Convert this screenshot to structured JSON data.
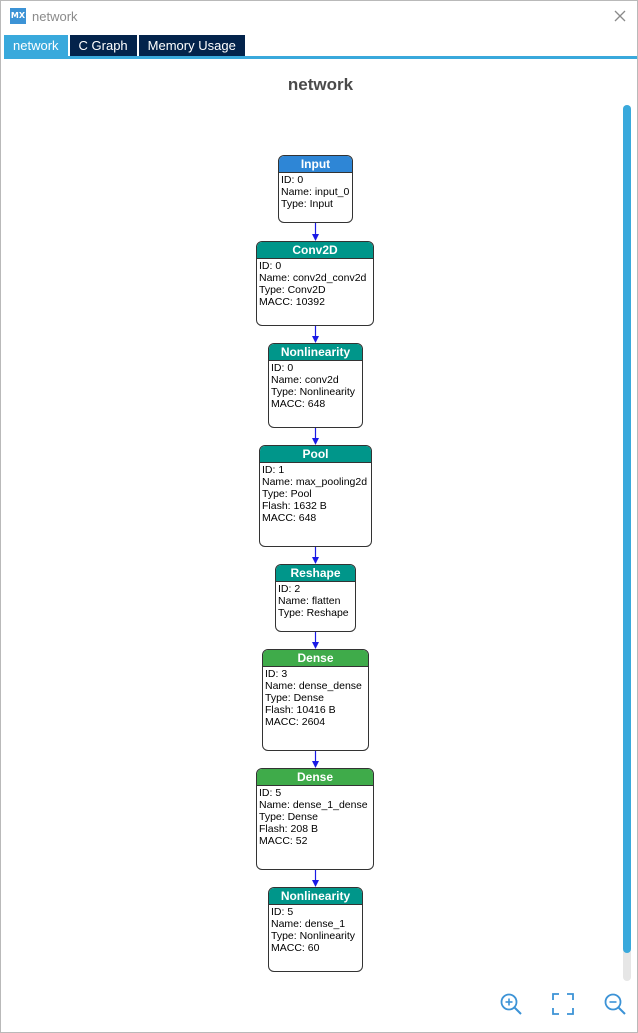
{
  "window": {
    "title": "network",
    "app_icon": "MX"
  },
  "tabs": [
    {
      "label": "network",
      "active": true
    },
    {
      "label": "C Graph",
      "active": false
    },
    {
      "label": "Memory Usage",
      "active": false
    }
  ],
  "graph": {
    "title": "network"
  },
  "nodes": [
    {
      "header": "Input",
      "color": "#2e86d6",
      "lines": [
        "ID: 0",
        "Name: input_0",
        "Type: Input"
      ]
    },
    {
      "header": "Conv2D",
      "color": "#00968a",
      "lines": [
        "ID: 0",
        "Name: conv2d_conv2d",
        "Type: Conv2D",
        "MACC: 10392"
      ]
    },
    {
      "header": "Nonlinearity",
      "color": "#00968a",
      "lines": [
        "ID: 0",
        "Name: conv2d",
        "Type: Nonlinearity",
        "MACC: 648"
      ]
    },
    {
      "header": "Pool",
      "color": "#00968a",
      "lines": [
        "ID: 1",
        "Name: max_pooling2d",
        "Type: Pool",
        "Flash: 1632 B",
        "MACC: 648"
      ]
    },
    {
      "header": "Reshape",
      "color": "#00968a",
      "lines": [
        "ID: 2",
        "Name: flatten",
        "Type: Reshape"
      ]
    },
    {
      "header": "Dense",
      "color": "#3fab4a",
      "lines": [
        "ID: 3",
        "Name: dense_dense",
        "Type: Dense",
        "Flash: 10416 B",
        "MACC: 2604"
      ]
    },
    {
      "header": "Dense",
      "color": "#3fab4a",
      "lines": [
        "ID: 5",
        "Name: dense_1_dense",
        "Type: Dense",
        "Flash: 208 B",
        "MACC: 52"
      ]
    },
    {
      "header": "Nonlinearity",
      "color": "#00968a",
      "lines": [
        "ID: 5",
        "Name: dense_1",
        "Type: Nonlinearity",
        "MACC: 60"
      ]
    }
  ],
  "toolbar": {
    "zoom_in_icon": "zoom-in-icon",
    "fit_icon": "fit-screen-icon",
    "zoom_out_icon": "zoom-out-icon",
    "color": "#3c93d6"
  }
}
